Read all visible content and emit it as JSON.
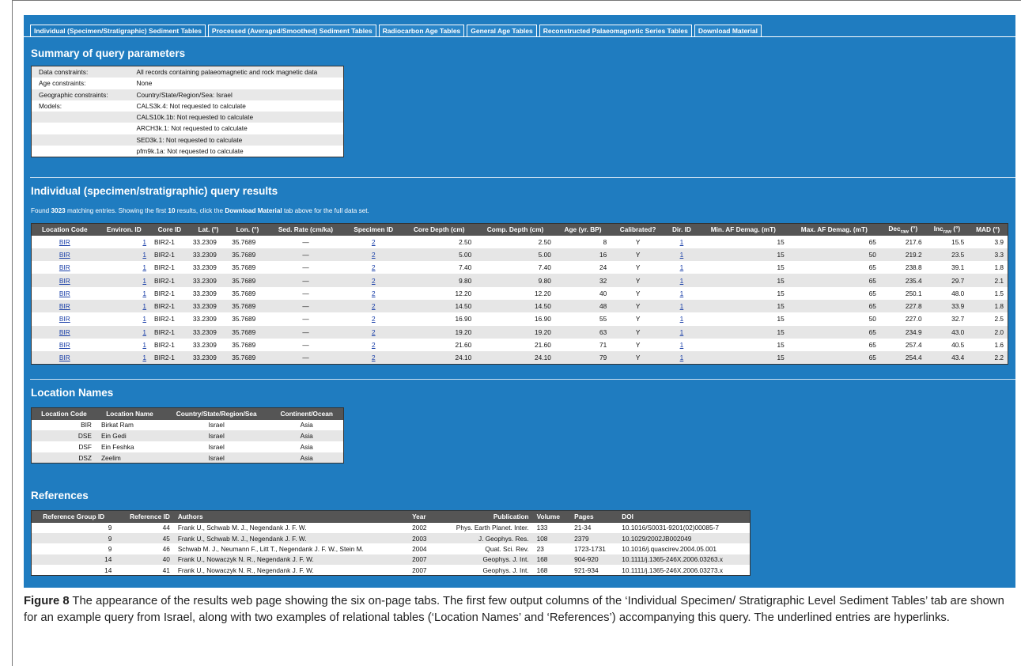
{
  "tabs": [
    "Individual (Specimen/Stratigraphic) Sediment Tables",
    "Processed (Averaged/Smoothed) Sediment Tables",
    "Radiocarbon Age Tables",
    "General Age Tables",
    "Reconstructed Palaeomagnetic Series Tables",
    "Download Material"
  ],
  "summary": {
    "heading": "Summary of query parameters",
    "rows": [
      [
        "Data constraints:",
        "All records containing palaeomagnetic and rock magnetic data"
      ],
      [
        "Age constraints:",
        "None"
      ],
      [
        "Geographic constraints:",
        "Country/State/Region/Sea: Israel"
      ],
      [
        "Models:",
        "CALS3k.4: Not requested to calculate"
      ],
      [
        "",
        "CALS10k.1b: Not requested to calculate"
      ],
      [
        "",
        "ARCH3k.1: Not requested to calculate"
      ],
      [
        "",
        "SED3k.1: Not requested to calculate"
      ],
      [
        "",
        "pfm9k.1a: Not requested to calculate"
      ]
    ]
  },
  "results": {
    "heading": "Individual (specimen/stratigraphic) query results",
    "found_pre": "Found ",
    "found_count": "3023",
    "found_mid": " matching entries. Showing the first ",
    "found_shown": "10",
    "found_mid2": " results, click the ",
    "found_tab": "Download Material",
    "found_post": " tab above for the full data set.",
    "headers": [
      "Location Code",
      "Environ. ID",
      "Core ID",
      "Lat. (°)",
      "Lon. (°)",
      "Sed. Rate (cm/ka)",
      "Specimen ID",
      "Core Depth (cm)",
      "Comp. Depth (cm)",
      "Age (yr. BP)",
      "Calibrated?",
      "Dir. ID",
      "Min. AF Demag. (mT)",
      "Max. AF Demag. (mT)"
    ],
    "dec_label": "Dec",
    "dec_sub": "raw",
    "dec_unit": " (°)",
    "inc_label": "Inc",
    "inc_sub": "raw",
    "inc_unit": " (°)",
    "mad_label": "MAD (°)",
    "rows": [
      [
        "BIR",
        "1",
        "BIR2-1",
        "33.2309",
        "35.7689",
        "—",
        "2",
        "2.50",
        "2.50",
        "8",
        "Y",
        "1",
        "15",
        "65",
        "217.6",
        "15.5",
        "3.9"
      ],
      [
        "BIR",
        "1",
        "BIR2-1",
        "33.2309",
        "35.7689",
        "—",
        "2",
        "5.00",
        "5.00",
        "16",
        "Y",
        "1",
        "15",
        "50",
        "219.2",
        "23.5",
        "3.3"
      ],
      [
        "BIR",
        "1",
        "BIR2-1",
        "33.2309",
        "35.7689",
        "—",
        "2",
        "7.40",
        "7.40",
        "24",
        "Y",
        "1",
        "15",
        "65",
        "238.8",
        "39.1",
        "1.8"
      ],
      [
        "BIR",
        "1",
        "BIR2-1",
        "33.2309",
        "35.7689",
        "—",
        "2",
        "9.80",
        "9.80",
        "32",
        "Y",
        "1",
        "15",
        "65",
        "235.4",
        "29.7",
        "2.1"
      ],
      [
        "BIR",
        "1",
        "BIR2-1",
        "33.2309",
        "35.7689",
        "—",
        "2",
        "12.20",
        "12.20",
        "40",
        "Y",
        "1",
        "15",
        "65",
        "250.1",
        "48.0",
        "1.5"
      ],
      [
        "BIR",
        "1",
        "BIR2-1",
        "33.2309",
        "35.7689",
        "—",
        "2",
        "14.50",
        "14.50",
        "48",
        "Y",
        "1",
        "15",
        "65",
        "227.8",
        "33.9",
        "1.8"
      ],
      [
        "BIR",
        "1",
        "BIR2-1",
        "33.2309",
        "35.7689",
        "—",
        "2",
        "16.90",
        "16.90",
        "55",
        "Y",
        "1",
        "15",
        "50",
        "227.0",
        "32.7",
        "2.5"
      ],
      [
        "BIR",
        "1",
        "BIR2-1",
        "33.2309",
        "35.7689",
        "—",
        "2",
        "19.20",
        "19.20",
        "63",
        "Y",
        "1",
        "15",
        "65",
        "234.9",
        "43.0",
        "2.0"
      ],
      [
        "BIR",
        "1",
        "BIR2-1",
        "33.2309",
        "35.7689",
        "—",
        "2",
        "21.60",
        "21.60",
        "71",
        "Y",
        "1",
        "15",
        "65",
        "257.4",
        "40.5",
        "1.6"
      ],
      [
        "BIR",
        "1",
        "BIR2-1",
        "33.2309",
        "35.7689",
        "—",
        "2",
        "24.10",
        "24.10",
        "79",
        "Y",
        "1",
        "15",
        "65",
        "254.4",
        "43.4",
        "2.2"
      ]
    ]
  },
  "locations": {
    "heading": "Location Names",
    "headers": [
      "Location Code",
      "Location Name",
      "Country/State/Region/Sea",
      "Continent/Ocean"
    ],
    "rows": [
      [
        "BIR",
        "Birkat Ram",
        "Israel",
        "Asia"
      ],
      [
        "DSE",
        "Ein Gedi",
        "Israel",
        "Asia"
      ],
      [
        "DSF",
        "Ein Feshka",
        "Israel",
        "Asia"
      ],
      [
        "DSZ",
        "Zeelim",
        "Israel",
        "Asia"
      ]
    ]
  },
  "references": {
    "heading": "References",
    "headers": [
      "Reference Group ID",
      "Reference ID",
      "Authors",
      "Year",
      "Publication",
      "Volume",
      "Pages",
      "DOI"
    ],
    "rows": [
      [
        "9",
        "44",
        "Frank U., Schwab M. J., Negendank J. F. W.",
        "2002",
        "Phys. Earth Planet. Inter.",
        "133",
        "21-34",
        "10.1016/S0031-9201(02)00085-7"
      ],
      [
        "9",
        "45",
        "Frank U., Schwab M. J., Negendank J. F. W.",
        "2003",
        "J. Geophys. Res.",
        "108",
        "2379",
        "10.1029/2002JB002049"
      ],
      [
        "9",
        "46",
        "Schwab M. J., Neumann F., Litt T., Negendank J. F. W., Stein M.",
        "2004",
        "Quat. Sci. Rev.",
        "23",
        "1723-1731",
        "10.1016/j.quascirev.2004.05.001"
      ],
      [
        "14",
        "40",
        "Frank U., Nowaczyk N. R., Negendank J. F. W.",
        "2007",
        "Geophys. J. Int.",
        "168",
        "904-920",
        "10.1111/j.1365-246X.2006.03263.x"
      ],
      [
        "14",
        "41",
        "Frank U., Nowaczyk N. R., Negendank J. F. W.",
        "2007",
        "Geophys. J. Int.",
        "168",
        "921-934",
        "10.1111/j.1365-246X.2006.03273.x"
      ]
    ]
  },
  "caption": {
    "label": "Figure 8",
    "text": "  The appearance of the results web page showing the six on-page tabs. The first few output columns of the ‘Individual Specimen/ Stratigraphic Level Sediment Tables’ tab are shown for an example query from Israel, along with two examples of relational tables (‘Location Names’ and ‘References’) accompanying this query. The underlined entries are hyperlinks."
  }
}
